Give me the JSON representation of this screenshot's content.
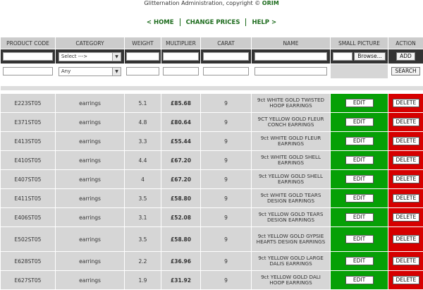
{
  "header": {
    "title_prefix": "Glitternation Administration, copyright ©",
    "brand": "ORIM"
  },
  "nav": {
    "home": "< HOME",
    "change_prices": "CHANGE PRICES",
    "help": "HELP >"
  },
  "columns": [
    "PRODUCT CODE",
    "CATEGORY",
    "WEIGHT",
    "MULTIPLIER",
    "CARAT",
    "NAME",
    "SMALL PICTURE",
    "ACTION"
  ],
  "form": {
    "category_select": "Select --->",
    "category_filter": "Any",
    "browse_label": "Browse...",
    "add_label": "ADD",
    "search_label": "SEARCH"
  },
  "actions": {
    "edit": "EDIT",
    "delete": "DELETE"
  },
  "rows": [
    {
      "code": "E223ST05",
      "category": "earrings",
      "weight": "5.1",
      "multiplier": "£85.68",
      "carat": "9",
      "name": "9ct WHITE GOLD TWISTED HOOP EARRINGS"
    },
    {
      "code": "E371ST05",
      "category": "earrings",
      "weight": "4.8",
      "multiplier": "£80.64",
      "carat": "9",
      "name": "9CT YELLOW GOLD FLEUR CONCH EARRINGS"
    },
    {
      "code": "E413ST05",
      "category": "earrings",
      "weight": "3.3",
      "multiplier": "£55.44",
      "carat": "9",
      "name": "9ct WHITE GOLD FLEUR EARRINGS"
    },
    {
      "code": "E410ST05",
      "category": "earrings",
      "weight": "4.4",
      "multiplier": "£67.20",
      "carat": "9",
      "name": "9ct WHITE GOLD SHELL EARRINGS"
    },
    {
      "code": "E407ST05",
      "category": "earrings",
      "weight": "4",
      "multiplier": "£67.20",
      "carat": "9",
      "name": "9ct YELLOW GOLD SHELL EARRINGS"
    },
    {
      "code": "E411ST05",
      "category": "earrings",
      "weight": "3.5",
      "multiplier": "£58.80",
      "carat": "9",
      "name": "9ct WHITE GOLD TEARS DESIGN EARRINGS"
    },
    {
      "code": "E406ST05",
      "category": "earrings",
      "weight": "3.1",
      "multiplier": "£52.08",
      "carat": "9",
      "name": "9ct YELLOW GOLD TEARS DESIGN EARRINGS"
    },
    {
      "code": "E502ST05",
      "category": "earrings",
      "weight": "3.5",
      "multiplier": "£58.80",
      "carat": "9",
      "name": "9ct YELLOW GOLD GYPSIE HEARTS DESIGN EARRINGS"
    },
    {
      "code": "E628ST05",
      "category": "earrings",
      "weight": "2.2",
      "multiplier": "£36.96",
      "carat": "9",
      "name": "9ct YELLOW GOLD LARGE DALIS EARRINGS"
    },
    {
      "code": "E627ST05",
      "category": "earrings",
      "weight": "1.9",
      "multiplier": "£31.92",
      "carat": "9",
      "name": "9ct YELLOW GOLD DALI HOOP EARRINGS"
    }
  ]
}
